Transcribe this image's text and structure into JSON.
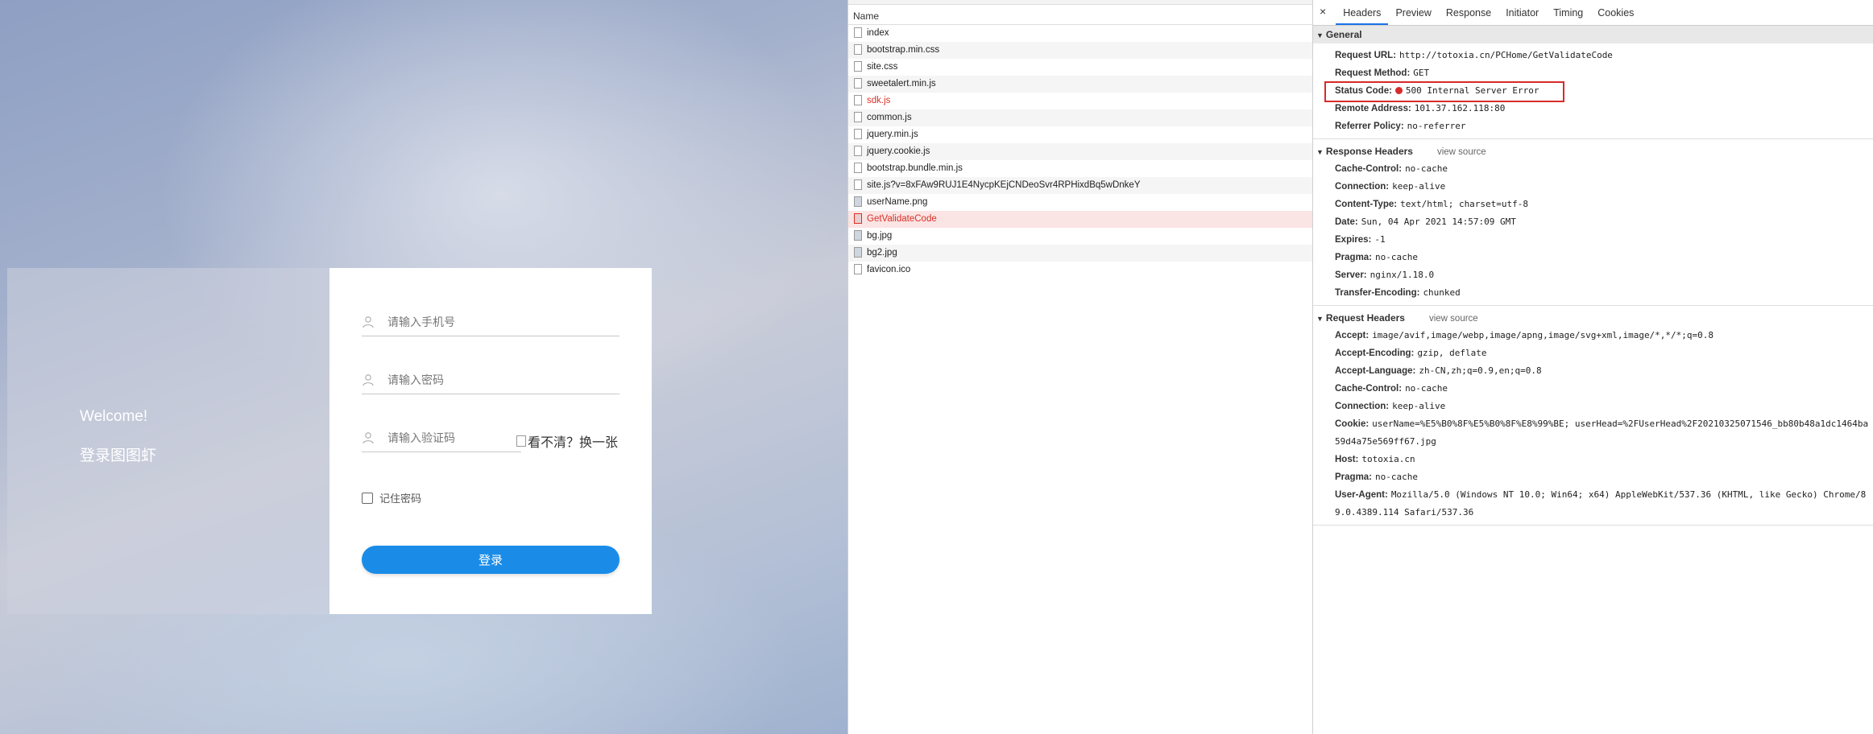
{
  "login": {
    "welcome": "Welcome!",
    "site_name": "登录图图虾",
    "phone_placeholder": "请输入手机号",
    "password_placeholder": "请输入密码",
    "captcha_placeholder": "请输入验证码",
    "captcha_alt": "看不清？换一张",
    "remember_label": "记住密码",
    "login_button": "登录"
  },
  "network": {
    "column_header": "Name",
    "files": [
      {
        "name": "index"
      },
      {
        "name": "bootstrap.min.css"
      },
      {
        "name": "site.css"
      },
      {
        "name": "sweetalert.min.js"
      },
      {
        "name": "sdk.js",
        "status": "error"
      },
      {
        "name": "common.js"
      },
      {
        "name": "jquery.min.js"
      },
      {
        "name": "jquery.cookie.js"
      },
      {
        "name": "bootstrap.bundle.min.js"
      },
      {
        "name": "site.js?v=8xFAw9RUJ1E4NycpKEjCNDeoSvr4RPHixdBq5wDnkeY"
      },
      {
        "name": "userName.png",
        "icon": "image"
      },
      {
        "name": "GetValidateCode",
        "status": "error",
        "selected": true
      },
      {
        "name": "bg.jpg",
        "icon": "image"
      },
      {
        "name": "bg2.jpg",
        "icon": "image"
      },
      {
        "name": "favicon.ico"
      }
    ]
  },
  "details": {
    "close": "×",
    "tabs": [
      "Headers",
      "Preview",
      "Response",
      "Initiator",
      "Timing",
      "Cookies"
    ],
    "active_tab": "Headers",
    "general": {
      "title": "General",
      "rows": [
        {
          "k": "Request URL:",
          "v": "http://totoxia.cn/PCHome/GetValidateCode"
        },
        {
          "k": "Request Method:",
          "v": "GET"
        },
        {
          "k": "Status Code:",
          "v": "500 Internal Server Error"
        },
        {
          "k": "Remote Address:",
          "v": "101.37.162.118:80"
        },
        {
          "k": "Referrer Policy:",
          "v": "no-referrer"
        }
      ]
    },
    "response_headers": {
      "title": "Response Headers",
      "view_source": "view source",
      "rows": [
        {
          "k": "Cache-Control:",
          "v": "no-cache"
        },
        {
          "k": "Connection:",
          "v": "keep-alive"
        },
        {
          "k": "Content-Type:",
          "v": "text/html; charset=utf-8"
        },
        {
          "k": "Date:",
          "v": "Sun, 04 Apr 2021 14:57:09 GMT"
        },
        {
          "k": "Expires:",
          "v": "-1"
        },
        {
          "k": "Pragma:",
          "v": "no-cache"
        },
        {
          "k": "Server:",
          "v": "nginx/1.18.0"
        },
        {
          "k": "Transfer-Encoding:",
          "v": "chunked"
        }
      ]
    },
    "request_headers": {
      "title": "Request Headers",
      "view_source": "view source",
      "rows": [
        {
          "k": "Accept:",
          "v": "image/avif,image/webp,image/apng,image/svg+xml,image/*,*/*;q=0.8"
        },
        {
          "k": "Accept-Encoding:",
          "v": "gzip, deflate"
        },
        {
          "k": "Accept-Language:",
          "v": "zh-CN,zh;q=0.9,en;q=0.8"
        },
        {
          "k": "Cache-Control:",
          "v": "no-cache"
        },
        {
          "k": "Connection:",
          "v": "keep-alive"
        },
        {
          "k": "Cookie:",
          "v": "userName=%E5%B0%8F%E5%B0%8F%E8%99%BE; userHead=%2FUserHead%2F20210325071546_bb80b48a1dc1464ba59d4a75e569ff67.jpg",
          "wrap": true
        },
        {
          "k": "Host:",
          "v": "totoxia.cn"
        },
        {
          "k": "Pragma:",
          "v": "no-cache"
        },
        {
          "k": "User-Agent:",
          "v": "Mozilla/5.0 (Windows NT 10.0; Win64; x64) AppleWebKit/537.36 (KHTML, like Gecko) Chrome/89.0.4389.114 Safari/537.36",
          "wrap": true
        }
      ]
    }
  }
}
